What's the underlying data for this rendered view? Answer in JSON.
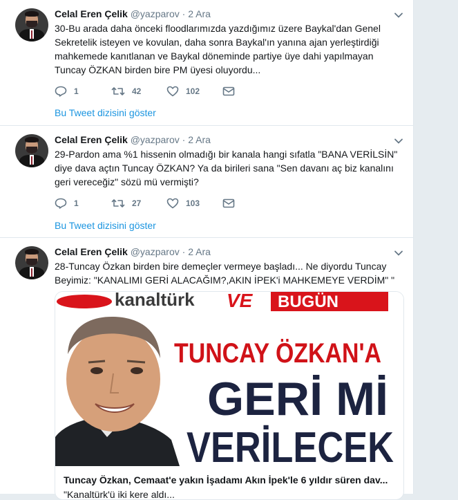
{
  "tweets": [
    {
      "name": "Celal Eren Çelik",
      "handle": "@yazparov",
      "separator": "·",
      "date": "2 Ara",
      "text": "30-Bu arada daha önceki floodlarımızda yazdığımız üzere Baykal'dan Genel Sekretelik isteyen ve kovulan, daha sonra Baykal'ın yanına ajan yerleştirdiği mahkemede kanıtlanan ve Baykal döneminde partiye üye dahi yapılmayan Tuncay ÖZKAN birden bire PM üyesi oluyordu...",
      "replies": "1",
      "retweets": "42",
      "likes": "102",
      "thread_link": "Bu Tweet dizisini göster"
    },
    {
      "name": "Celal Eren Çelik",
      "handle": "@yazparov",
      "separator": "·",
      "date": "2 Ara",
      "text": "29-Pardon ama %1 hissenin olmadığı bir kanala hangi sıfatla \"BANA VERİLSİN\" diye dava açtın Tuncay ÖZKAN? Ya da birileri sana \"Sen davanı aç biz kanalını geri vereceğiz\" sözü mü vermişti?",
      "replies": "1",
      "retweets": "27",
      "likes": "103",
      "thread_link": "Bu Tweet dizisini göster"
    },
    {
      "name": "Celal Eren Çelik",
      "handle": "@yazparov",
      "separator": "·",
      "date": "2 Ara",
      "text": "28-Tuncay Özkan birden bire demeçler vermeye başladı... Ne diyordu Tuncay Beyimiz: \"KANALIMI GERİ ALACAĞIM?,AKIN İPEK'i MAHKEMEYE VERDİM\" \""
    }
  ],
  "card": {
    "image_logo_left": "kanaltürk",
    "image_logo_mid": "VE",
    "image_logo_right": "BUGÜN",
    "headline_line1": "TUNCAY ÖZKAN'A",
    "headline_line2": "GERİ Mİ",
    "headline_line3": "VERİLECEK",
    "title": "Tuncay Özkan, Cemaat'e yakın İşadamı Akın İpek'le 6 yıldır süren dav...",
    "description": "\"Kanaltürk'ü iki kere aldı..."
  },
  "colors": {
    "link": "#1b95e0",
    "secondary_text": "#657786",
    "primary_text": "#14171a",
    "divider": "#e1e8ed",
    "background": "#e6ecf0",
    "logo_red": "#d9141b",
    "headline_red": "#d01218",
    "headline_navy": "#1c2340"
  },
  "icons": {
    "reply": "reply-icon",
    "retweet": "retweet-icon",
    "like": "heart-icon",
    "message": "envelope-icon",
    "menu": "chevron-down-icon"
  }
}
